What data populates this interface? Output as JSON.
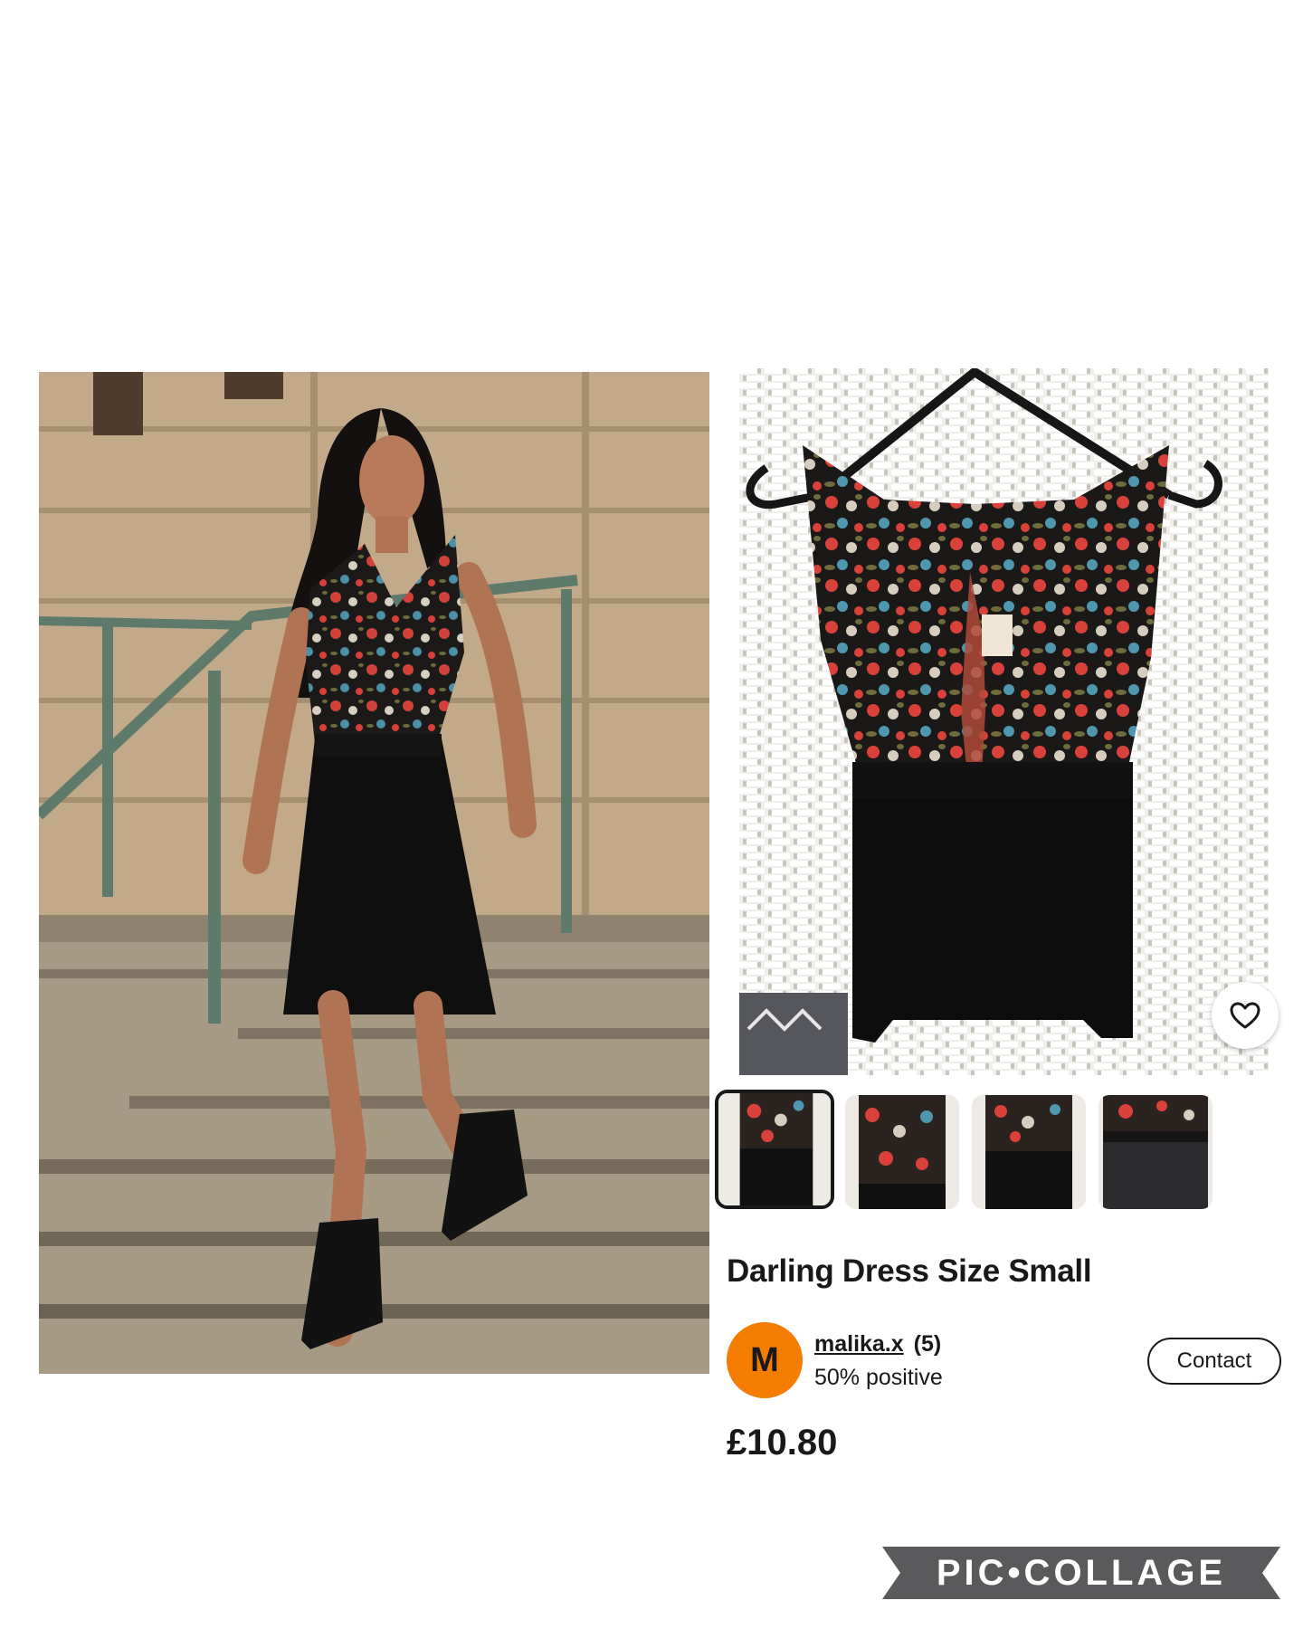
{
  "listing": {
    "title": "Darling Dress Size Small",
    "price": "£10.80",
    "favorite_icon": "heart-outline-icon"
  },
  "seller": {
    "avatar_initial": "M",
    "name": "malika.x",
    "feedback_count": "(5)",
    "feedback_percent": "50% positive",
    "avatar_color": "#f47c00"
  },
  "actions": {
    "contact_label": "Contact"
  },
  "gallery": {
    "thumbnail_count": 4,
    "selected_index": 0
  },
  "watermark": {
    "text": "PIC•COLLAGE"
  },
  "colors": {
    "text": "#191919",
    "background": "#ffffff",
    "accent": "#f47c00"
  }
}
